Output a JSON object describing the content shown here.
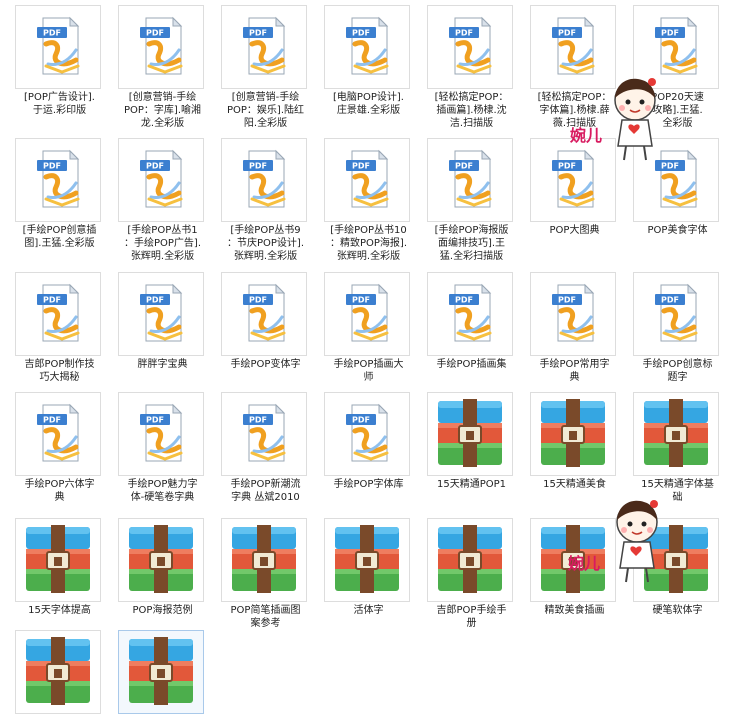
{
  "watermark_text": "婉儿",
  "items": [
    {
      "label": "[POP广告设计].\n于运.彩印版",
      "type": "pdf"
    },
    {
      "label": "[创意营销-手绘\nPOP：字库].喻湘\n龙.全彩版",
      "type": "pdf"
    },
    {
      "label": "[创意营销-手绘\nPOP：娱乐].陆红\n阳.全彩版",
      "type": "pdf"
    },
    {
      "label": "[电脑POP设计].\n庄景雄.全彩版",
      "type": "pdf"
    },
    {
      "label": "[轻松搞定POP：\n插画篇].杨棣.沈\n洁.扫描版",
      "type": "pdf"
    },
    {
      "label": "[轻松搞定POP：\n字体篇].杨棣.薛\n薇.扫描版",
      "type": "pdf"
    },
    {
      "label": "POP20天速\n攻略].王猛.\n全彩版",
      "type": "pdf"
    },
    {
      "label": "[手绘POP创意插\n图].王猛.全彩版",
      "type": "pdf"
    },
    {
      "label": "[手绘POP丛书1\n：手绘POP广告].\n张辉明.全彩版",
      "type": "pdf"
    },
    {
      "label": "[手绘POP丛书9\n：节庆POP设计].\n张辉明.全彩版",
      "type": "pdf"
    },
    {
      "label": "[手绘POP丛书10\n：精致POP海报].\n张辉明.全彩版",
      "type": "pdf"
    },
    {
      "label": "[手绘POP海报版\n面编排技巧].王\n猛.全彩扫描版",
      "type": "pdf"
    },
    {
      "label": "POP大图典",
      "type": "pdf"
    },
    {
      "label": "POP美食字体",
      "type": "pdf"
    },
    {
      "label": "吉郎POP制作技\n巧大揭秘",
      "type": "pdf"
    },
    {
      "label": "胖胖字宝典",
      "type": "pdf"
    },
    {
      "label": "手绘POP变体字",
      "type": "pdf"
    },
    {
      "label": "手绘POP插画大\n师",
      "type": "pdf"
    },
    {
      "label": "手绘POP插画集",
      "type": "pdf"
    },
    {
      "label": "手绘POP常用字\n典",
      "type": "pdf"
    },
    {
      "label": "手绘POP创意标\n题字",
      "type": "pdf"
    },
    {
      "label": "手绘POP六体字\n典",
      "type": "pdf"
    },
    {
      "label": "手绘POP魅力字\n体-硬笔卷字典",
      "type": "pdf"
    },
    {
      "label": "手绘POP新潮流\n字典 丛斌2010",
      "type": "pdf"
    },
    {
      "label": "手绘POP字体库",
      "type": "pdf"
    },
    {
      "label": "15天精通POP1",
      "type": "rar"
    },
    {
      "label": "15天精通美食",
      "type": "rar"
    },
    {
      "label": "15天精通字体基\n础",
      "type": "rar"
    },
    {
      "label": "15天字体提高",
      "type": "rar"
    },
    {
      "label": "POP海报范例",
      "type": "rar"
    },
    {
      "label": "POP简笔插画图\n案参考",
      "type": "rar"
    },
    {
      "label": "活体字",
      "type": "rar"
    },
    {
      "label": "吉郎POP手绘手\n册",
      "type": "rar"
    },
    {
      "label": "精致美食插画",
      "type": "rar"
    },
    {
      "label": "硬笔软体字",
      "type": "rar"
    },
    {
      "label": "",
      "type": "rar"
    },
    {
      "label": "",
      "type": "rar",
      "selected": true
    }
  ]
}
